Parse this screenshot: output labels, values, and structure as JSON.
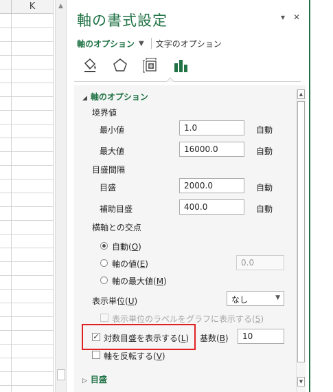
{
  "sheet": {
    "column_label": "K"
  },
  "pane": {
    "title": "軸の書式設定",
    "pin_glyph": "▾",
    "close_glyph": "✕",
    "tab_axis_options": "軸のオプション",
    "tab_text_options": "文字のオプション",
    "icons": [
      "fill-line-icon",
      "effects-icon",
      "size-properties-icon",
      "axis-options-icon"
    ]
  },
  "axis_options": {
    "header": "軸のオプション",
    "bounds_label": "境界値",
    "min_label": "最小値",
    "min_value": "1.0",
    "min_auto": "自動",
    "max_label": "最大値",
    "max_value": "16000.0",
    "max_auto": "自動",
    "units_label": "目盛間隔",
    "major_label": "目盛",
    "major_value": "2000.0",
    "major_auto": "自動",
    "minor_label": "補助目盛",
    "minor_value": "400.0",
    "minor_auto": "自動",
    "crosses_label": "横軸との交点",
    "radio_auto": "自動(",
    "radio_auto_key": "O",
    "radio_auto_end": ")",
    "radio_value": "軸の値(",
    "radio_value_key": "E",
    "radio_value_end": ")",
    "radio_value_input": "0.0",
    "radio_max": "軸の最大値(",
    "radio_max_key": "M",
    "radio_max_end": ")",
    "display_units_label": "表示単位(",
    "display_units_key": "U",
    "display_units_end": ")",
    "display_units_value": "なし",
    "show_units_label": "表示単位のラベルをグラフに表示する(",
    "show_units_key": "S",
    "show_units_end": ")",
    "log_scale_label": "対数目盛を表示する(",
    "log_scale_key": "L",
    "log_scale_end": ")",
    "log_scale_checked": true,
    "base_label": "基数(",
    "base_key": "B",
    "base_end": ")",
    "base_value": "10",
    "reverse_label": "軸を反転する(",
    "reverse_key": "V",
    "reverse_end": ")",
    "reverse_checked": false,
    "tick_marks_header": "目盛"
  },
  "colors": {
    "accent": "#217346",
    "highlight": "#e02020"
  }
}
